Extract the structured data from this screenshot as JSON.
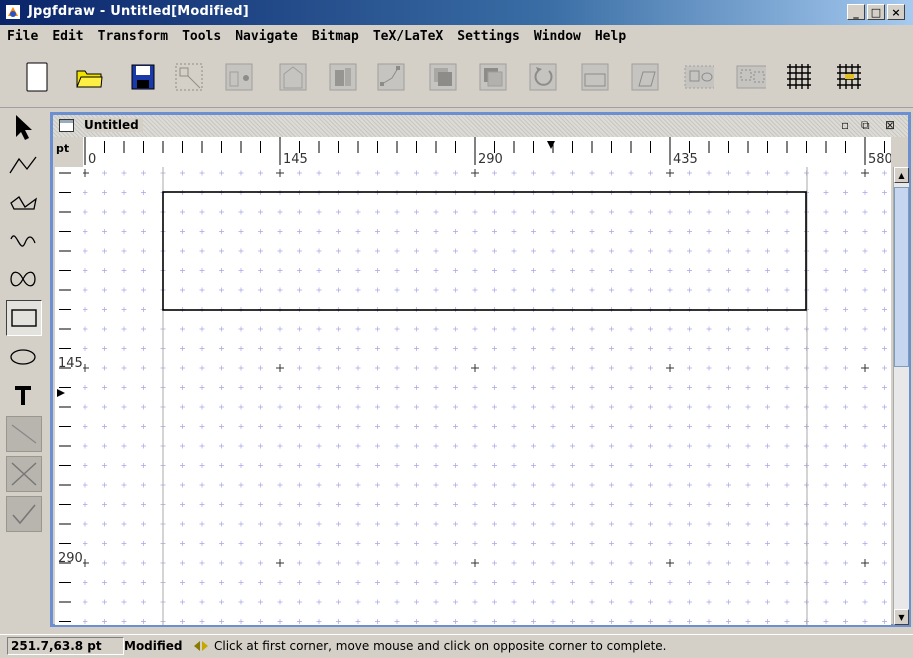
{
  "window": {
    "title": "Jpgfdraw - Untitled[Modified]"
  },
  "menu": [
    "File",
    "Edit",
    "Transform",
    "Tools",
    "Navigate",
    "Bitmap",
    "TeX/LaTeX",
    "Settings",
    "Window",
    "Help"
  ],
  "toolbar": {
    "buttons": [
      {
        "name": "new-button",
        "icon": "new-document-icon",
        "enabled": true
      },
      {
        "name": "open-button",
        "icon": "folder-icon",
        "enabled": true
      },
      {
        "name": "save-button",
        "icon": "floppy-disk-icon",
        "enabled": true
      },
      {
        "name": "select-all-button",
        "icon": "select-all-icon",
        "enabled": false
      },
      {
        "name": "move-button",
        "icon": "move-icon",
        "enabled": false
      },
      {
        "name": "grid-button",
        "icon": "grid-icon",
        "enabled": false
      },
      {
        "name": "edit-path-button",
        "icon": "edit-path-icon",
        "enabled": false
      },
      {
        "name": "path-button",
        "icon": "path-icon",
        "enabled": false
      },
      {
        "name": "move-to-front-button",
        "icon": "front-icon",
        "enabled": false
      },
      {
        "name": "move-to-back-button",
        "icon": "back-icon",
        "enabled": false
      },
      {
        "name": "rotate-button",
        "icon": "rotate-icon",
        "enabled": false
      },
      {
        "name": "scale-button",
        "icon": "scale-icon",
        "enabled": false
      },
      {
        "name": "shear-button",
        "icon": "shear-icon",
        "enabled": false
      },
      {
        "name": "group-button",
        "icon": "group-icon",
        "enabled": false
      },
      {
        "name": "ungroup-button",
        "icon": "ungroup-icon",
        "enabled": false
      },
      {
        "name": "show-grid-button",
        "icon": "show-grid-icon",
        "enabled": true
      },
      {
        "name": "lock-grid-button",
        "icon": "lock-grid-icon",
        "enabled": true
      }
    ]
  },
  "tools": [
    {
      "name": "select-tool",
      "icon": "arrow-icon",
      "enabled": true,
      "selected": false
    },
    {
      "name": "open-line-tool",
      "icon": "open-line-icon",
      "enabled": true,
      "selected": false
    },
    {
      "name": "closed-line-tool",
      "icon": "closed-line-icon",
      "enabled": true,
      "selected": false
    },
    {
      "name": "open-curve-tool",
      "icon": "open-curve-icon",
      "enabled": true,
      "selected": false
    },
    {
      "name": "closed-curve-tool",
      "icon": "closed-curve-icon",
      "enabled": true,
      "selected": false
    },
    {
      "name": "rectangle-tool",
      "icon": "rectangle-icon",
      "enabled": true,
      "selected": true
    },
    {
      "name": "ellipse-tool",
      "icon": "ellipse-icon",
      "enabled": true,
      "selected": false
    },
    {
      "name": "text-tool",
      "icon": "text-T-icon",
      "enabled": true,
      "selected": false
    },
    {
      "name": "gap-tool",
      "icon": "gap-icon",
      "enabled": false,
      "selected": false
    },
    {
      "name": "abandon-tool",
      "icon": "cross-icon",
      "enabled": false,
      "selected": false
    },
    {
      "name": "finish-tool",
      "icon": "checkmark-icon",
      "enabled": false,
      "selected": false
    }
  ],
  "document": {
    "title": "Untitled",
    "unit": "pt",
    "h_ruler_labels": [
      "0",
      "145",
      "290",
      "435",
      "580"
    ],
    "v_ruler_labels": [
      "145",
      "290"
    ]
  },
  "status": {
    "coords": "251.7,63.8 pt",
    "modified": "Modified",
    "message": "Click at first corner, move mouse and click on opposite corner to complete."
  },
  "colors": {
    "title_bar_start": "#0a246a",
    "title_bar_end": "#a6caf0",
    "inner_frame": "#6b8fd0",
    "grid_dot": "#a6a6e6"
  }
}
